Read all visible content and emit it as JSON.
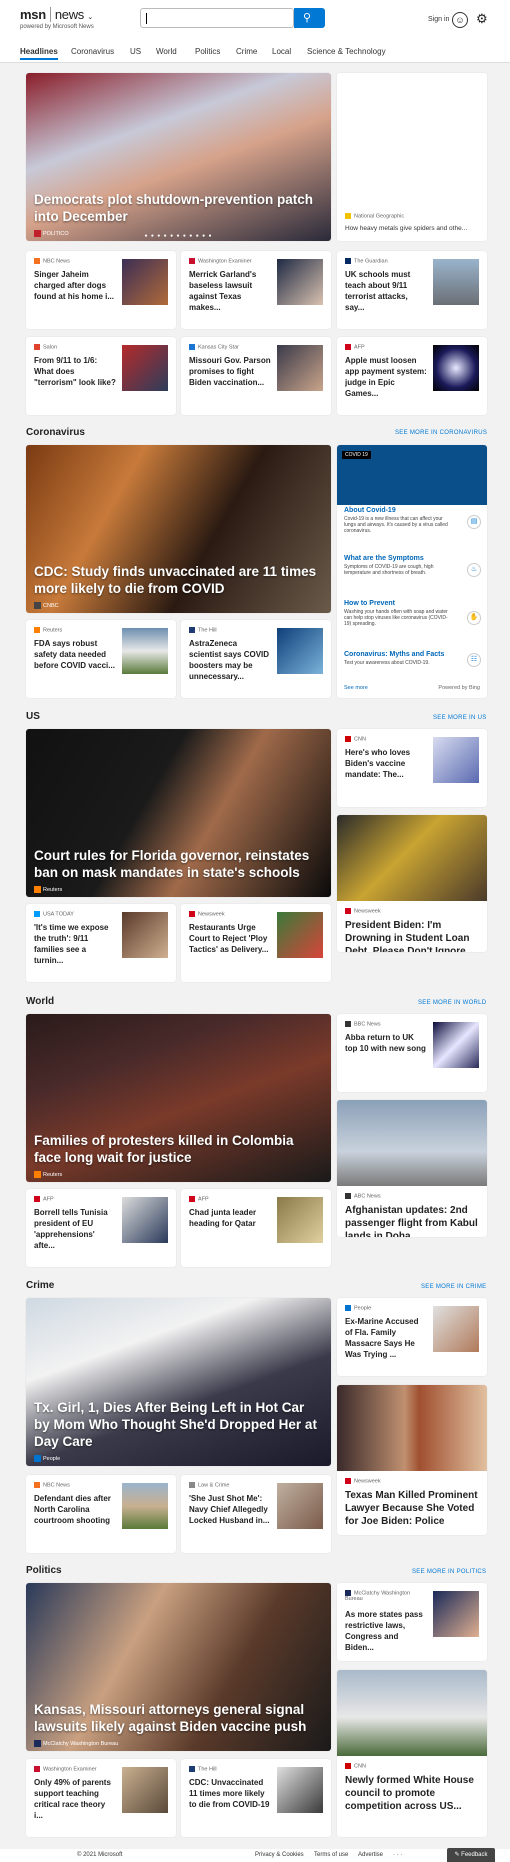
{
  "header": {
    "logo": "msn",
    "section": "news",
    "tagline": "powered by Microsoft News",
    "search_value": "",
    "sign_in": "Sign in"
  },
  "nav": [
    "Headlines",
    "Coronavirus",
    "US",
    "World",
    "Politics",
    "Crime",
    "Local",
    "Science & Technology"
  ],
  "headlines": {
    "hero": {
      "title": "Democrats plot shutdown-prevention patch into December",
      "source": "POLITICO"
    },
    "side": {
      "source": "National Geographic",
      "title": "How heavy metals give spiders and othe..."
    },
    "cards": [
      {
        "source": "NBC News",
        "title": "Singer Jaheim charged after dogs found at his home i..."
      },
      {
        "source": "Washington Examiner",
        "title": "Merrick Garland's baseless lawsuit against Texas makes..."
      },
      {
        "source": "The Guardian",
        "title": "UK schools must teach about 9/11 terrorist attacks, say..."
      },
      {
        "source": "Salon",
        "title": "From 9/11 to 1/6: What does \"terrorism\" look like?"
      },
      {
        "source": "Kansas City Star",
        "title": "Missouri Gov. Parson promises to fight Biden vaccination..."
      },
      {
        "source": "AFP",
        "title": "Apple must loosen app payment system: judge in Epic Games..."
      }
    ]
  },
  "coronavirus": {
    "heading": "Coronavirus",
    "more": "SEE MORE IN CORONAVIRUS",
    "hero": {
      "title": "CDC: Study finds unvaccinated are 11 times more likely to die from COVID",
      "source": "CNBC"
    },
    "cards": [
      {
        "source": "Reuters",
        "title": "FDA says robust safety data needed before COVID vacci..."
      },
      {
        "source": "The Hill",
        "title": "AstraZeneca scientist says COVID boosters may be unnecessary..."
      }
    ],
    "panel": {
      "tag": "COVID 19",
      "items": [
        {
          "title": "About Covid-19",
          "text": "Covid-19 is a new illness that can affect your lungs and airways. It's caused by a virus called coronavirus."
        },
        {
          "title": "What are the Symptoms",
          "text": "Symptoms of COVID-19 are cough, high temperature and shortness of breath."
        },
        {
          "title": "How to Prevent",
          "text": "Washing your hands often with soap and water can help stop viruses like coronavirus (COVID-19) spreading."
        },
        {
          "title": "Coronavirus: Myths and Facts",
          "text": "Test your awareness about COVID-19."
        }
      ],
      "see_more": "See more",
      "powered": "Powered by Bing"
    }
  },
  "us": {
    "heading": "US",
    "more": "SEE MORE IN US",
    "hero": {
      "title": "Court rules for Florida governor, reinstates ban on mask mandates in state's schools",
      "source": "Reuters"
    },
    "side": {
      "source": "CNN",
      "title": "Here's who loves Biden's vaccine mandate: The..."
    },
    "tall": {
      "source": "Newsweek",
      "title": "President Biden: I'm Drowning in Student Loan Debt. Please Don't Ignore ..."
    },
    "cards": [
      {
        "source": "USA TODAY",
        "title": "'It's time we expose the truth': 9/11 families see a turnin..."
      },
      {
        "source": "Newsweek",
        "title": "Restaurants Urge Court to Reject 'Ploy Tactics' as Delivery..."
      }
    ]
  },
  "world": {
    "heading": "World",
    "more": "SEE MORE IN WORLD",
    "hero": {
      "title": "Families of protesters killed in Colombia face long wait for justice",
      "source": "Reuters"
    },
    "side": {
      "source": "BBC News",
      "title": "Abba return to UK top 10 with new song"
    },
    "tall": {
      "source": "ABC News",
      "title": "Afghanistan updates: 2nd passenger flight from Kabul lands in Doha"
    },
    "cards": [
      {
        "source": "AFP",
        "title": "Borrell tells Tunisia president of EU 'apprehensions' afte..."
      },
      {
        "source": "AFP",
        "title": "Chad junta leader heading for Qatar"
      }
    ]
  },
  "crime": {
    "heading": "Crime",
    "more": "SEE MORE IN CRIME",
    "hero": {
      "title": "Tx. Girl, 1, Dies After Being Left in Hot Car by Mom Who Thought She'd Dropped Her at Day Care",
      "source": "People"
    },
    "side": {
      "source": "People",
      "title": "Ex-Marine Accused of Fla. Family Massacre Says He Was Trying ..."
    },
    "tall": {
      "source": "Newsweek",
      "title": "Texas Man Killed Prominent Lawyer Because She Voted for Joe Biden: Police"
    },
    "cards": [
      {
        "source": "NBC News",
        "title": "Defendant dies after North Carolina courtroom shooting"
      },
      {
        "source": "Law & Crime",
        "title": "'She Just Shot Me': Navy Chief Allegedly Locked Husband in..."
      }
    ]
  },
  "politics": {
    "heading": "Politics",
    "more": "SEE MORE IN POLITICS",
    "hero": {
      "title": "Kansas, Missouri attorneys general signal lawsuits likely against Biden vaccine push",
      "source": "McClatchy Washington Bureau"
    },
    "side": {
      "source": "McClatchy Washington Bureau",
      "title": "As more states pass restrictive laws, Congress and Biden..."
    },
    "tall": {
      "source": "CNN",
      "title": "Newly formed White House council to promote competition across US..."
    },
    "cards": [
      {
        "source": "Washington Examiner",
        "title": "Only 49% of parents support teaching critical race theory i..."
      },
      {
        "source": "The Hill",
        "title": "CDC: Unvaccinated 11 times more likely to die from COVID-19"
      }
    ]
  },
  "footer": {
    "copyright": "© 2021 Microsoft",
    "links": [
      "Privacy & Cookies",
      "Terms of use",
      "Advertise"
    ],
    "ellipsis": "· · ·",
    "feedback": "Feedback"
  },
  "colors": {
    "accent": "#0078d4"
  }
}
